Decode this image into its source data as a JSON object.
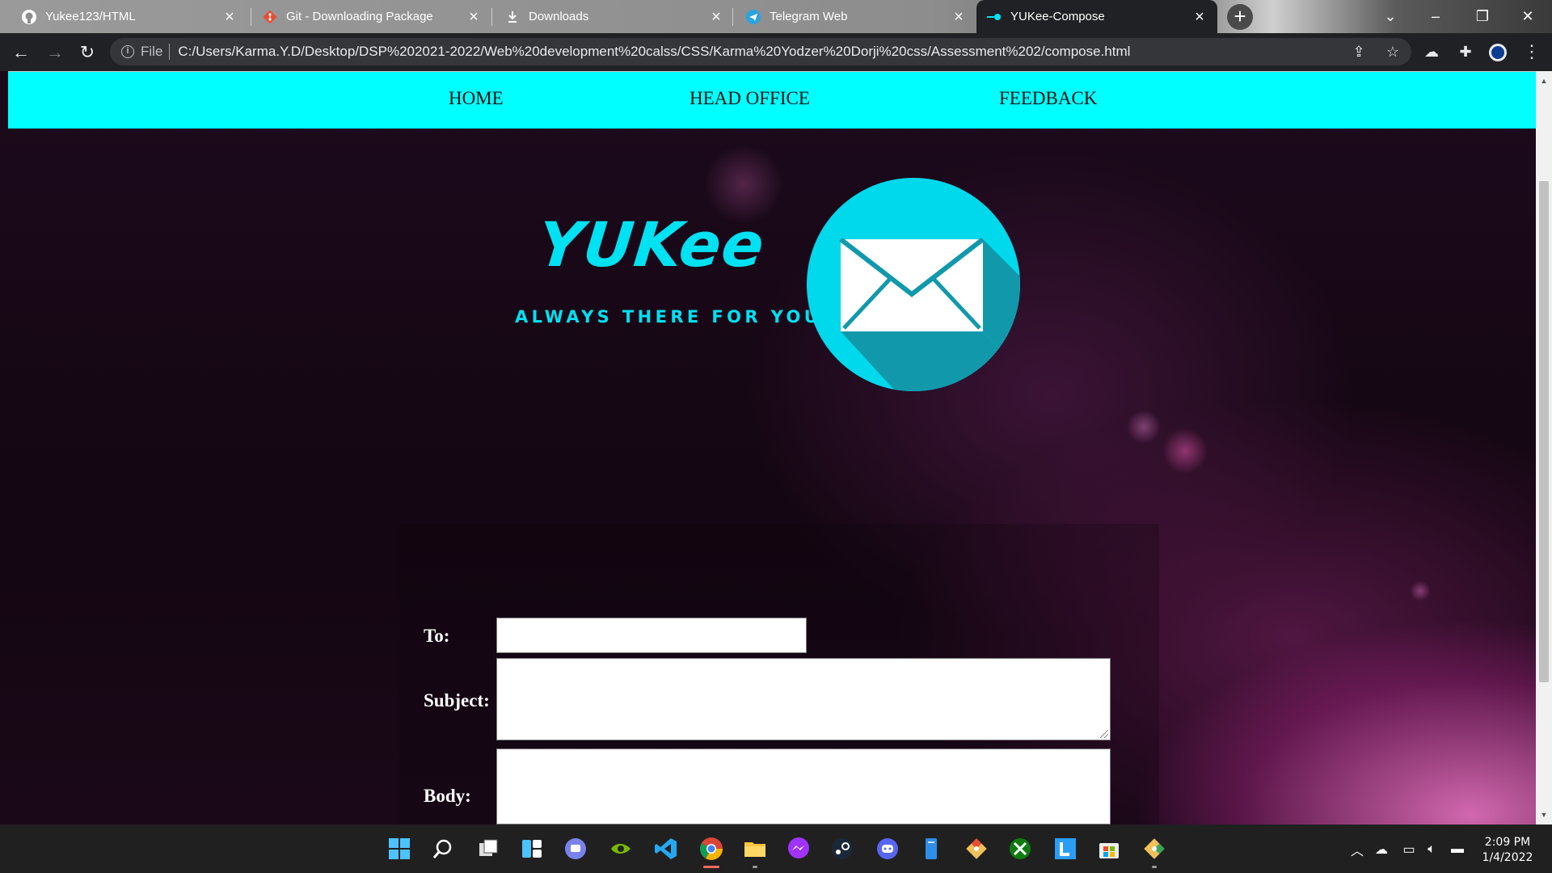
{
  "browser": {
    "tabs": [
      {
        "title": "Yukee123/HTML",
        "icon": "github-icon"
      },
      {
        "title": "Git - Downloading Package",
        "icon": "git-icon"
      },
      {
        "title": "Downloads",
        "icon": "download-icon"
      },
      {
        "title": "Telegram Web",
        "icon": "telegram-icon"
      },
      {
        "title": "YUKee-Compose",
        "icon": "page-icon",
        "active": true
      }
    ],
    "address": {
      "scheme": "File",
      "url": "C:/Users/Karma.Y.D/Desktop/DSP%202021-2022/Web%20development%20calss/CSS/Karma%20Yodzer%20Dorji%20css/Assessment%202/compose.html"
    }
  },
  "nav": {
    "items": [
      "HOME",
      "HEAD OFFICE",
      "FEEDBACK"
    ]
  },
  "logo": {
    "title": "YUKee",
    "tagline": "ALWAYS THERE FOR YOU",
    "accent": "#00e1f2"
  },
  "form": {
    "to_label": "To:",
    "subject_label": "Subject:",
    "body_label": "Body:",
    "to_value": "",
    "subject_value": "",
    "body_value": ""
  },
  "taskbar": {
    "apps": [
      "windows-start-icon",
      "search-icon",
      "task-view-icon",
      "widgets-icon",
      "teams-chat-icon",
      "nvidia-icon",
      "vscode-icon",
      "chrome-icon",
      "file-explorer-icon",
      "messenger-icon",
      "steam-icon",
      "discord-icon",
      "notepad-icon",
      "git-icon",
      "xbox-icon",
      "lively-icon",
      "store-icon",
      "git-gui-icon"
    ],
    "time": "2:09 PM",
    "date": "1/4/2022"
  },
  "colors": {
    "nav_bar": "#00ffff",
    "page_bg": "#140612"
  }
}
